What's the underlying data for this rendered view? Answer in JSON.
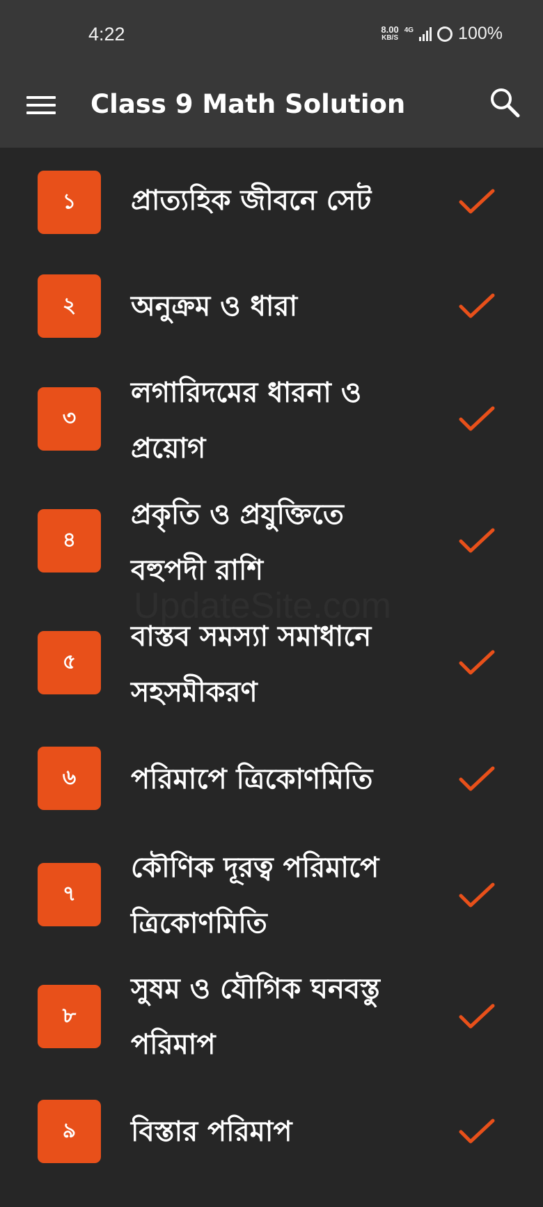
{
  "status_bar": {
    "time": "4:22",
    "net_speed": "8.00",
    "net_unit": "KB/S",
    "net_type": "4G",
    "battery": "100%"
  },
  "app_bar": {
    "title": "Class 9 Math Solution"
  },
  "watermark": "UpdateSite.com",
  "accent_color": "#e8501a",
  "chapters": [
    {
      "number": "১",
      "title": "প্রাত্যহিক জীবনে সেট"
    },
    {
      "number": "২",
      "title": "অনুক্রম ও ধারা"
    },
    {
      "number": "৩",
      "title": "লগারিদমের ধারনা ও প্রয়োগ"
    },
    {
      "number": "৪",
      "title": "প্রকৃতি ও প্রযুক্তিতে বহুপদী রাশি"
    },
    {
      "number": "৫",
      "title": "বাস্তব সমস্যা সমাধানে সহসমীকরণ"
    },
    {
      "number": "৬",
      "title": "পরিমাপে ত্রিকোণমিতি"
    },
    {
      "number": "৭",
      "title": "কৌণিক দূরত্ব পরিমাপে ত্রিকোণমিতি"
    },
    {
      "number": "৮",
      "title": "সুষম ও যৌগিক ঘনবস্তু পরিমাপ"
    },
    {
      "number": "৯",
      "title": "বিস্তার পরিমাপ"
    }
  ]
}
